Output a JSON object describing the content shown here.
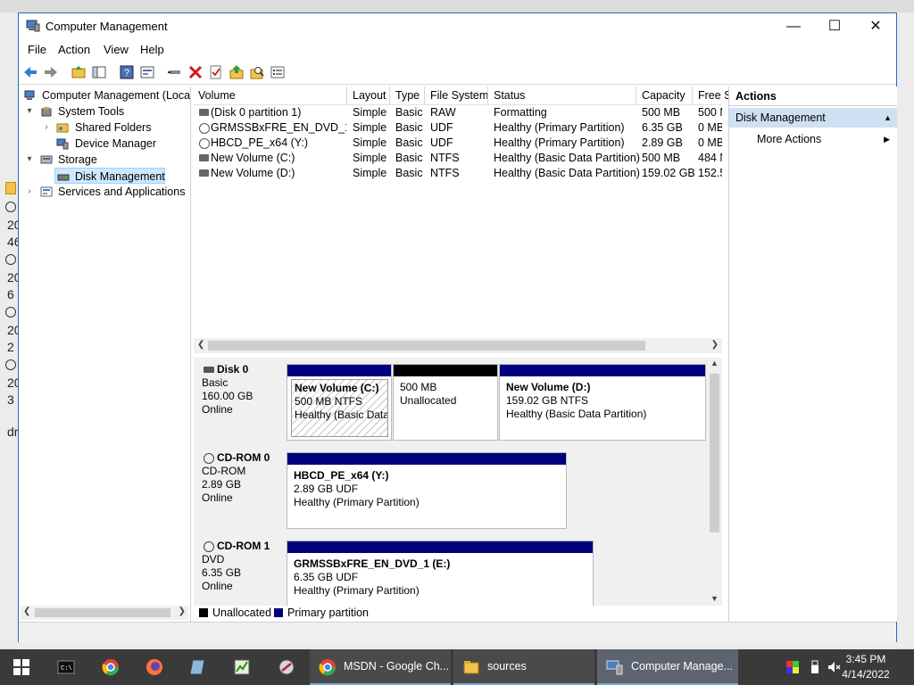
{
  "window": {
    "title": "Computer Management",
    "controls": {
      "minimize": "—",
      "maximize": "☐",
      "close": "✕"
    }
  },
  "menu": [
    "File",
    "Action",
    "View",
    "Help"
  ],
  "tree": {
    "root": "Computer Management (Local",
    "system_tools": "System Tools",
    "shared_folders": "Shared Folders",
    "device_manager": "Device Manager",
    "storage": "Storage",
    "disk_management": "Disk Management",
    "services": "Services and Applications"
  },
  "volumes": {
    "columns": [
      "Volume",
      "Layout",
      "Type",
      "File System",
      "Status",
      "Capacity",
      "Free S"
    ],
    "rows": [
      {
        "volume": "(Disk 0 partition 1)",
        "layout": "Simple",
        "type": "Basic",
        "fs": "RAW",
        "status": "Formatting",
        "capacity": "500 MB",
        "free": "500 M",
        "icon": "drive-icon"
      },
      {
        "volume": "GRMSSBxFRE_EN_DVD_1 (E:)",
        "layout": "Simple",
        "type": "Basic",
        "fs": "UDF",
        "status": "Healthy (Primary Partition)",
        "capacity": "6.35 GB",
        "free": "0 MB",
        "icon": "cd-icon"
      },
      {
        "volume": "HBCD_PE_x64 (Y:)",
        "layout": "Simple",
        "type": "Basic",
        "fs": "UDF",
        "status": "Healthy (Primary Partition)",
        "capacity": "2.89 GB",
        "free": "0 MB",
        "icon": "cd-icon"
      },
      {
        "volume": "New Volume (C:)",
        "layout": "Simple",
        "type": "Basic",
        "fs": "NTFS",
        "status": "Healthy (Basic Data Partition)",
        "capacity": "500 MB",
        "free": "484 M",
        "icon": "drive-icon"
      },
      {
        "volume": "New Volume (D:)",
        "layout": "Simple",
        "type": "Basic",
        "fs": "NTFS",
        "status": "Healthy (Basic Data Partition)",
        "capacity": "159.02 GB",
        "free": "152.5",
        "icon": "drive-icon"
      }
    ]
  },
  "disks": [
    {
      "name": "Disk 0",
      "kind": "Basic",
      "size": "160.00 GB",
      "state": "Online"
    },
    {
      "name": "CD-ROM 0",
      "kind": "CD-ROM",
      "size": "2.89 GB",
      "state": "Online"
    },
    {
      "name": "CD-ROM 1",
      "kind": "DVD",
      "size": "6.35 GB",
      "state": "Online"
    }
  ],
  "partitions": {
    "disk0": [
      {
        "name": "New Volume  (C:)",
        "line1": "500 MB NTFS",
        "line2": "Healthy (Basic Data"
      },
      {
        "name": "",
        "line1": "500 MB",
        "line2": "Unallocated"
      },
      {
        "name": "New Volume  (D:)",
        "line1": "159.02 GB NTFS",
        "line2": "Healthy (Basic Data Partition)"
      }
    ],
    "cdrom0": {
      "name": "HBCD_PE_x64  (Y:)",
      "line1": "2.89 GB UDF",
      "line2": "Healthy (Primary Partition)"
    },
    "cdrom1": {
      "name": "GRMSSBxFRE_EN_DVD_1  (E:)",
      "line1": "6.35 GB UDF",
      "line2": "Healthy (Primary Partition)"
    }
  },
  "legend": [
    {
      "label": "Unallocated",
      "color": "#000000"
    },
    {
      "label": "Primary partition",
      "color": "#00007f"
    }
  ],
  "colors": {
    "primary": "#00007f",
    "unallocated": "#000000",
    "selection": "#cce8ff",
    "action_section": "#cfe0f2"
  },
  "actions": {
    "header": "Actions",
    "section": "Disk Management",
    "more": "More Actions"
  },
  "background_fragments": [
    "20",
    "46",
    "20",
    "6",
    "20",
    "2",
    "20",
    "3",
    "dr"
  ],
  "taskbar": {
    "tasks": [
      {
        "label": "MSDN - Google Ch..."
      },
      {
        "label": "sources"
      },
      {
        "label": "Computer Manage..."
      }
    ],
    "time": "3:45 PM",
    "date": "4/14/2022"
  }
}
